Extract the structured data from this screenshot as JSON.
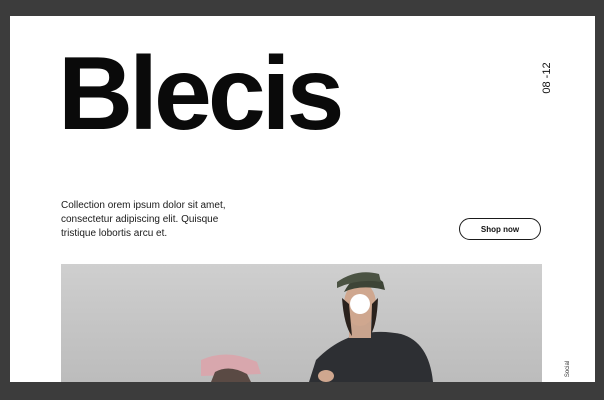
{
  "brand": {
    "title": "Blecis"
  },
  "date": "08 -12",
  "description": "Collection orem ipsum dolor sit amet, consectetur adipiscing elit. Quisque tristique lobortis arcu et.",
  "cta": {
    "label": "Shop now"
  },
  "sidebar": {
    "social_label": "Social"
  },
  "colors": {
    "background": "#3c3c3c",
    "page": "#ffffff",
    "text": "#0a0a0a"
  },
  "hero": {
    "image": "photo-two-people-in-caps"
  }
}
